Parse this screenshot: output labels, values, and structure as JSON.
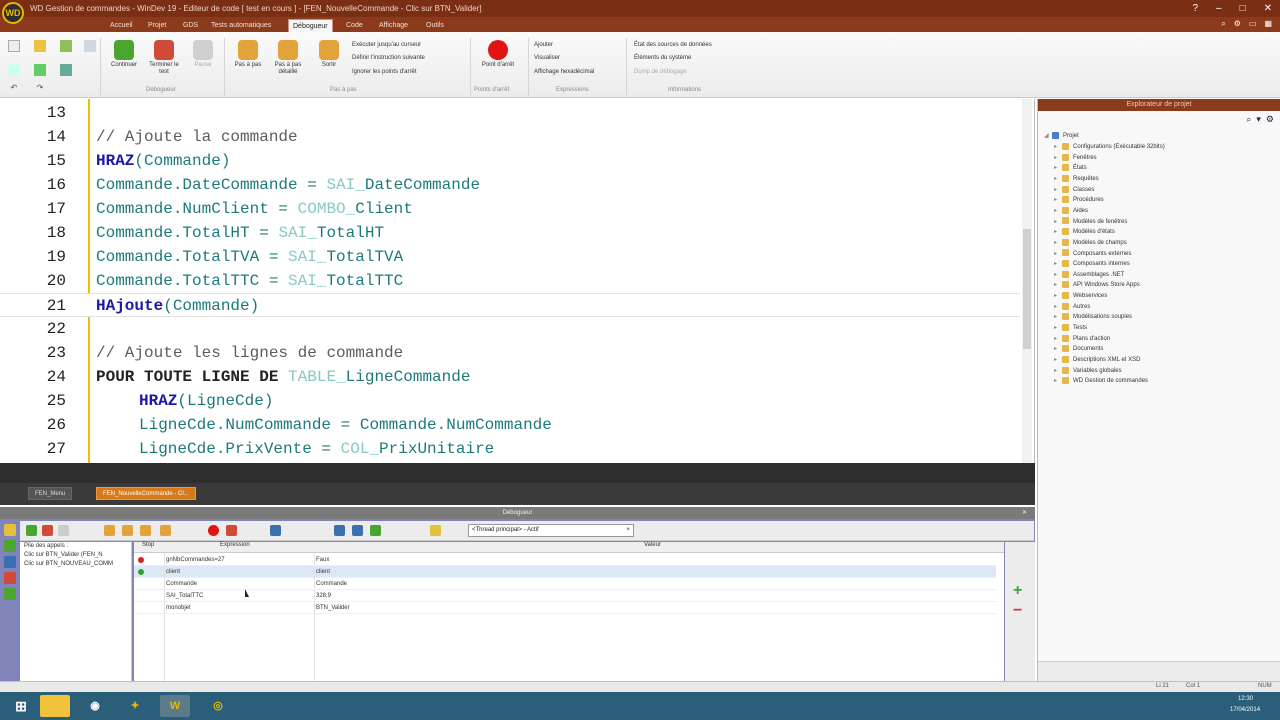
{
  "window": {
    "title": "WD Gestion de commandes - WinDev 19 - Editeur de code [ test en cours ] - [FEN_NouvelleCommande - Clic sur BTN_Valider]",
    "logo": "WD"
  },
  "menu": {
    "tabs": [
      "Accueil",
      "Projet",
      "GDS",
      "Tests automatiques",
      "Débogueur",
      "Code",
      "Affichage",
      "Outils"
    ],
    "active": "Débogueur"
  },
  "ribbon": {
    "continue": "Continuer",
    "stop_test": "Terminer le test",
    "pause": "Pause",
    "group_debug": "Débogueur",
    "step_into": "Pas à pas",
    "step_detail": "Pas à pas détaillé",
    "step_out": "Sortir",
    "run_to_cursor": "Exécuter jusqu'au curseur",
    "set_next": "Définir l'instruction suivante",
    "ignore_bp": "Ignorer les points d'arrêt",
    "group_step": "Pas à pas",
    "breakpoint": "Point d'arrêt",
    "group_breakpoint": "Points d'arrêt",
    "add": "Ajouter",
    "view": "Visualiser",
    "hex": "Affichage hexadécimal",
    "group_expr": "Expressions",
    "ds_state": "État des sources de données",
    "sys_elements": "Éléments du système",
    "dump": "Dump de débogage",
    "group_info": "Informations"
  },
  "code": {
    "lines": [
      {
        "n": "13",
        "parts": []
      },
      {
        "n": "14",
        "parts": [
          {
            "c": "cmt",
            "t": "// Ajoute la commande"
          }
        ]
      },
      {
        "n": "15",
        "parts": [
          {
            "c": "kw",
            "t": "HRAZ"
          },
          {
            "c": "plain",
            "t": "(Commande)"
          }
        ]
      },
      {
        "n": "16",
        "parts": [
          {
            "c": "var",
            "t": "Commande.DateCommande = "
          },
          {
            "c": "ctl",
            "t": "SAI_"
          },
          {
            "c": "var",
            "t": "DateCommande"
          }
        ]
      },
      {
        "n": "17",
        "parts": [
          {
            "c": "var",
            "t": "Commande.NumClient = "
          },
          {
            "c": "ctl",
            "t": "COMBO_"
          },
          {
            "c": "var",
            "t": "Client"
          }
        ]
      },
      {
        "n": "18",
        "parts": [
          {
            "c": "var",
            "t": "Commande.TotalHT = "
          },
          {
            "c": "ctl",
            "t": "SAI_"
          },
          {
            "c": "var",
            "t": "TotalHT"
          }
        ]
      },
      {
        "n": "19",
        "parts": [
          {
            "c": "var",
            "t": "Commande.TotalTVA = "
          },
          {
            "c": "ctl",
            "t": "SAI_"
          },
          {
            "c": "var",
            "t": "TotalTVA"
          }
        ]
      },
      {
        "n": "20",
        "parts": [
          {
            "c": "var",
            "t": "Commande.TotalTTC = "
          },
          {
            "c": "ctl",
            "t": "SAI_"
          },
          {
            "c": "var",
            "t": "TotalTTC"
          }
        ]
      },
      {
        "n": "21",
        "parts": [
          {
            "c": "kw",
            "t": "HAjoute"
          },
          {
            "c": "plain",
            "t": "(Commande)"
          }
        ]
      },
      {
        "n": "22",
        "parts": []
      },
      {
        "n": "23",
        "parts": [
          {
            "c": "cmt",
            "t": "// Ajoute les lignes de commande"
          }
        ]
      },
      {
        "n": "24",
        "parts": [
          {
            "c": "kwb",
            "t": "POUR TOUTE LIGNE DE "
          },
          {
            "c": "ctl",
            "t": "TABLE_"
          },
          {
            "c": "var",
            "t": "LigneCommande"
          }
        ]
      },
      {
        "n": "25",
        "parts": [
          {
            "c": "ind",
            "t": ""
          },
          {
            "c": "kw",
            "t": "HRAZ"
          },
          {
            "c": "plain",
            "t": "(LigneCde)"
          }
        ]
      },
      {
        "n": "26",
        "parts": [
          {
            "c": "ind",
            "t": ""
          },
          {
            "c": "var",
            "t": "LigneCde.NumCommande = Commande.NumCommande"
          }
        ]
      },
      {
        "n": "27",
        "parts": [
          {
            "c": "ind",
            "t": ""
          },
          {
            "c": "var",
            "t": "LigneCde.PrixVente = "
          },
          {
            "c": "ctl",
            "t": "COL_"
          },
          {
            "c": "var",
            "t": "PrixUnitaire"
          }
        ]
      }
    ]
  },
  "explorer": {
    "title": "Explorateur de projet",
    "root": "Projet",
    "items": [
      "Configurations (Exécutable 32bits)",
      "Fenêtres",
      "États",
      "Requêtes",
      "Classes",
      "Procédures",
      "Aides",
      "Modèles de fenêtres",
      "Modèles d'états",
      "Modèles de champs",
      "Composants externes",
      "Composants internes",
      "Assemblages .NET",
      "API Windows Store Apps",
      "Webservices",
      "Autres",
      "Modélisations souples",
      "Tests",
      "Plans d'action",
      "Documents",
      "Descriptions XML et XSD",
      "Variables globales",
      "WD Gestion de commandes"
    ]
  },
  "doc_tabs": [
    "FEN_Menu",
    "FEN_NouvelleCommande - Cl..."
  ],
  "debugger": {
    "title": "Débogueur",
    "thread": "<Thread principal> - Actif",
    "callstack_label": "Pile des appels :",
    "calls": [
      "Clic sur BTN_Valider (FEN_N",
      "Clic sur BTN_NOUVEAU_COMM"
    ],
    "cols": {
      "stop": "Stop",
      "expr": "Expression",
      "value": "Valeur"
    },
    "rows": [
      {
        "expr": "gnNbCommandes=27",
        "value": "Faux",
        "stop": "red"
      },
      {
        "expr": "client",
        "value": "client",
        "stop": "green"
      },
      {
        "expr": "Commande",
        "value": "Commande",
        "stop": ""
      },
      {
        "expr": "SAI_TotalTTC",
        "value": "328,9",
        "stop": ""
      },
      {
        "expr": "monobjet",
        "value": "BTN_Valider",
        "stop": ""
      }
    ]
  },
  "status": {
    "line": "Li 21",
    "col": "Col 1",
    "num": "NUM"
  },
  "taskbar": {
    "time": "12:30",
    "date": "17/04/2014"
  }
}
